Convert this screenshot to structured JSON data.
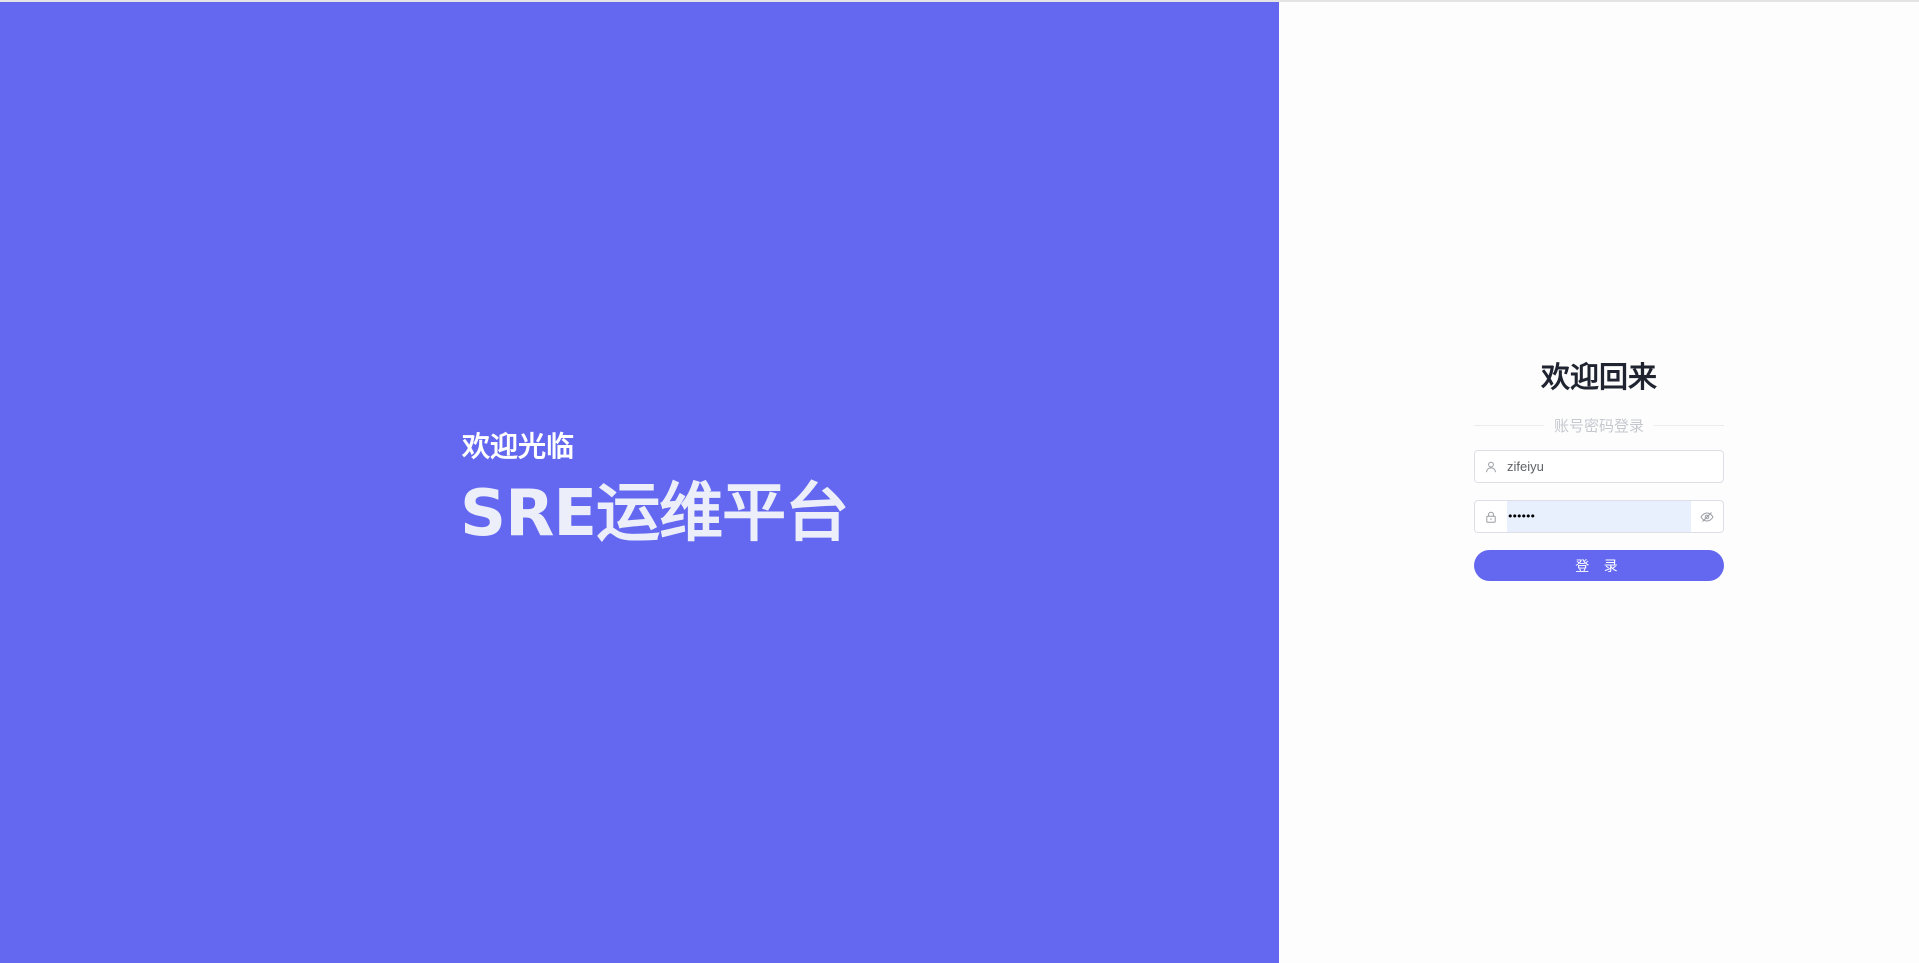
{
  "hero": {
    "welcome": "欢迎光临",
    "title": "SRE运维平台"
  },
  "login": {
    "title": "欢迎回来",
    "method_label": "账号密码登录",
    "username_value": "zifeiyu",
    "password_mask": "••••••",
    "submit_label": "登 录"
  },
  "icons": {
    "username_prefix": "user-icon",
    "password_prefix": "lock-icon",
    "password_suffix": "eye-hidden-icon"
  },
  "colors": {
    "brand": "#6468f0",
    "title_text": "#1f2430",
    "autofill_bg": "#e8f0fe"
  }
}
